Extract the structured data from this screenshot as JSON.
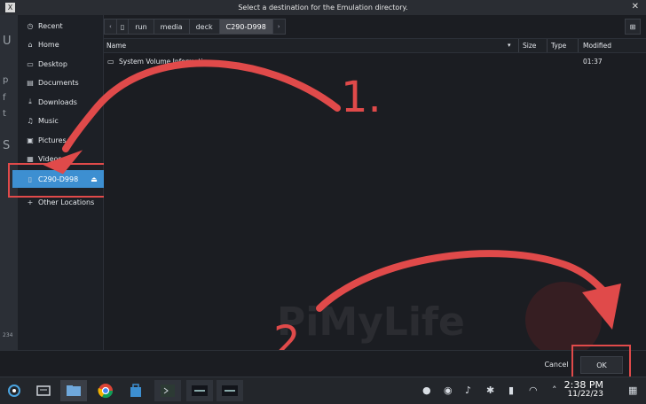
{
  "window": {
    "title": "Select a destination for the Emulation directory.",
    "app_icon": "X",
    "close": "✕"
  },
  "sidebar": {
    "items": [
      {
        "label": "Recent",
        "icon": "clock-icon",
        "glyph": "◷"
      },
      {
        "label": "Home",
        "icon": "home-icon",
        "glyph": "⌂"
      },
      {
        "label": "Desktop",
        "icon": "desktop-icon",
        "glyph": "▭"
      },
      {
        "label": "Documents",
        "icon": "documents-icon",
        "glyph": "▤"
      },
      {
        "label": "Downloads",
        "icon": "downloads-icon",
        "glyph": "⤓"
      },
      {
        "label": "Music",
        "icon": "music-icon",
        "glyph": "♫"
      },
      {
        "label": "Pictures",
        "icon": "pictures-icon",
        "glyph": "▣"
      },
      {
        "label": "Videos",
        "icon": "videos-icon",
        "glyph": "▦"
      },
      {
        "label": "C290-D998",
        "icon": "drive-icon",
        "glyph": "▯"
      },
      {
        "label": "Other Locations",
        "icon": "plus-icon",
        "glyph": "+"
      }
    ],
    "eject_glyph": "⏏"
  },
  "pathbar": {
    "back": "‹",
    "forward": "›",
    "device_glyph": "▯",
    "segments": [
      "run",
      "media",
      "deck",
      "C290-D998"
    ],
    "new_folder_glyph": "⊞"
  },
  "columns": {
    "name": "Name",
    "size": "Size",
    "type": "Type",
    "modified": "Modified",
    "sort_glyph": "▾"
  },
  "files": [
    {
      "name": "System Volume Information",
      "size": "",
      "type": "",
      "modified": "01:37"
    }
  ],
  "actions": {
    "cancel": "Cancel",
    "ok": "OK"
  },
  "annotations": {
    "step1": "1.",
    "step2": "2.",
    "color": "#e04a4a"
  },
  "watermark": "PiMyLife",
  "taskbar": {
    "time": "2:38 PM",
    "date": "11/22/23"
  },
  "background": {
    "page_number": "234"
  }
}
